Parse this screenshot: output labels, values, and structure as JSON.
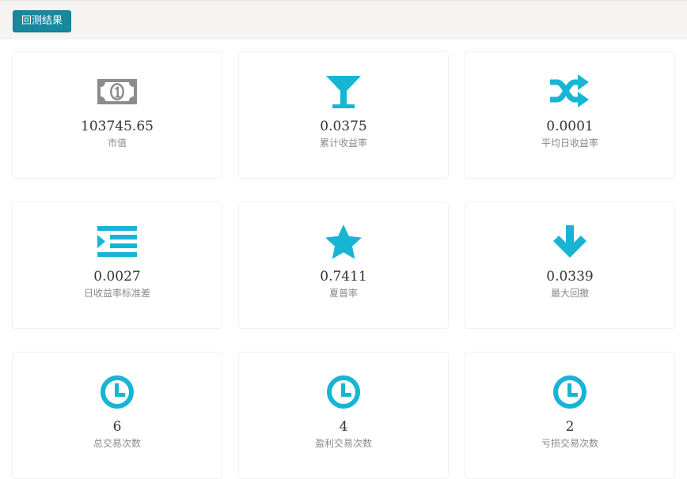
{
  "toolbar": {
    "backtest_button": "回测结果"
  },
  "colors": {
    "accent": "#16b5d4",
    "button": "#17889e",
    "money_icon": "#8c8c8c"
  },
  "metrics": [
    {
      "icon": "money-icon",
      "value": "103745.65",
      "label": "市值"
    },
    {
      "icon": "cocktail-glass-icon",
      "value": "0.0375",
      "label": "累计收益率"
    },
    {
      "icon": "shuffle-icon",
      "value": "0.0001",
      "label": "平均日收益率"
    },
    {
      "icon": "indent-list-icon",
      "value": "0.0027",
      "label": "日收益率标准差"
    },
    {
      "icon": "star-icon",
      "value": "0.7411",
      "label": "夏普率"
    },
    {
      "icon": "arrow-down-icon",
      "value": "0.0339",
      "label": "最大回撤"
    },
    {
      "icon": "clock-icon",
      "value": "6",
      "label": "总交易次数"
    },
    {
      "icon": "clock-icon",
      "value": "4",
      "label": "盈利交易次数"
    },
    {
      "icon": "clock-icon",
      "value": "2",
      "label": "亏损交易次数"
    }
  ]
}
